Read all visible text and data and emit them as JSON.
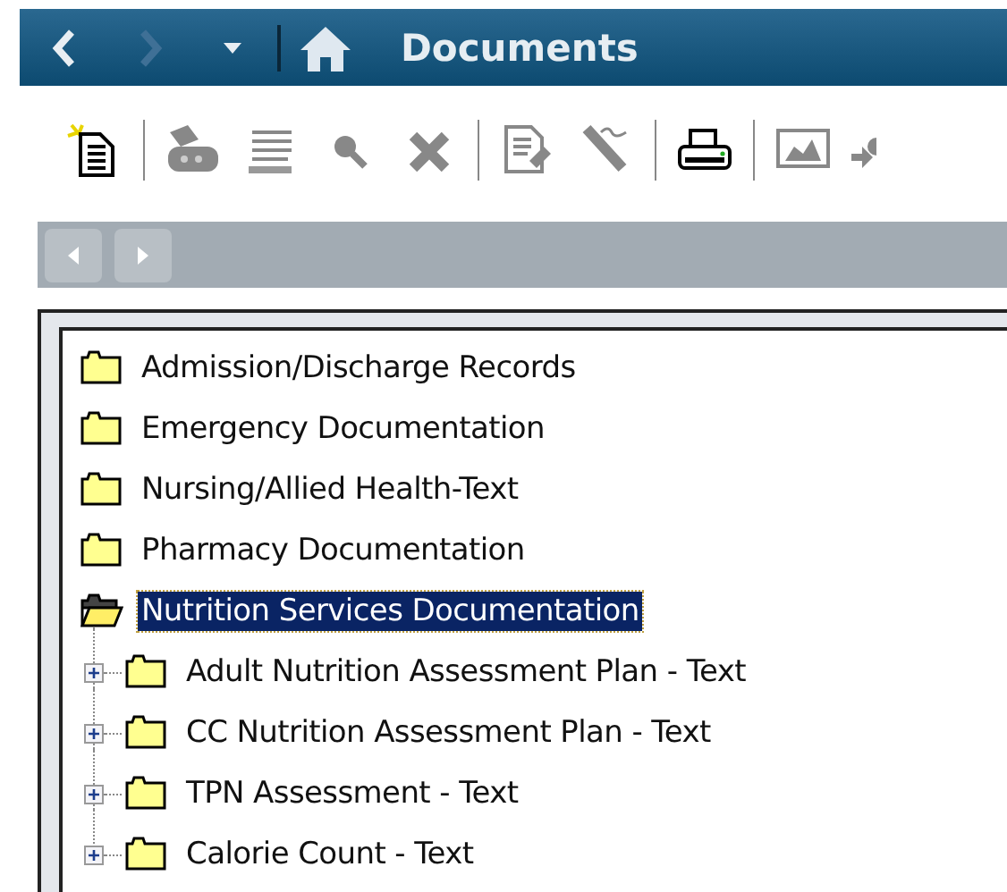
{
  "header": {
    "title": "Documents",
    "back": {
      "disabled": false
    },
    "forward": {
      "disabled": true
    }
  },
  "tree": [
    {
      "label": "Admission/Discharge Records",
      "expanded": false,
      "selected": false
    },
    {
      "label": "Emergency Documentation",
      "expanded": false,
      "selected": false
    },
    {
      "label": "Nursing/Allied Health-Text",
      "expanded": false,
      "selected": false
    },
    {
      "label": "Pharmacy Documentation",
      "expanded": false,
      "selected": false
    },
    {
      "label": "Nutrition Services Documentation",
      "expanded": true,
      "selected": true,
      "children": [
        {
          "label": "Adult Nutrition Assessment Plan - Text",
          "expanded": false,
          "selected": false
        },
        {
          "label": "CC Nutrition Assessment Plan - Text",
          "expanded": false,
          "selected": false
        },
        {
          "label": "TPN Assessment - Text",
          "expanded": false,
          "selected": false
        },
        {
          "label": "Calorie Count - Text",
          "expanded": false,
          "selected": false
        }
      ]
    }
  ]
}
